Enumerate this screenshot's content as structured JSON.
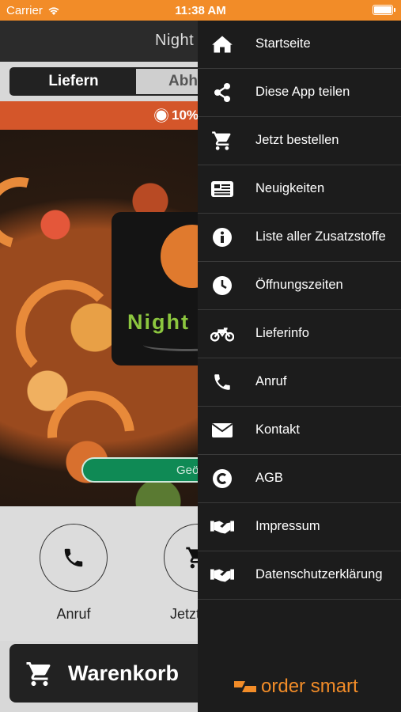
{
  "status_bar": {
    "carrier": "Carrier",
    "time": "11:38 AM"
  },
  "navbar": {
    "title": "Night I"
  },
  "order_mode": {
    "deliver_label": "Liefern",
    "pickup_label": "Abholen",
    "selected": "Liefern"
  },
  "promo": {
    "text": "10%"
  },
  "restaurant": {
    "logo_text": "Night",
    "status_pill": "Geö"
  },
  "quick_actions": [
    {
      "label": "Anruf",
      "icon": "phone-icon"
    },
    {
      "label": "Jetzt b",
      "icon": "cart-icon"
    }
  ],
  "cart": {
    "label": "Warenkorb"
  },
  "drawer": {
    "items": [
      {
        "label": "Startseite",
        "icon": "home-icon"
      },
      {
        "label": "Diese App teilen",
        "icon": "share-icon"
      },
      {
        "label": "Jetzt bestellen",
        "icon": "cart-icon"
      },
      {
        "label": "Neuigkeiten",
        "icon": "newspaper-icon"
      },
      {
        "label": "Liste aller Zusatzstoffe",
        "icon": "info-icon"
      },
      {
        "label": "Öffnungszeiten",
        "icon": "clock-icon"
      },
      {
        "label": "Lieferinfo",
        "icon": "motorcycle-icon"
      },
      {
        "label": "Anruf",
        "icon": "phone-icon"
      },
      {
        "label": "Kontakt",
        "icon": "envelope-icon"
      },
      {
        "label": "AGB",
        "icon": "copyright-icon"
      },
      {
        "label": "Impressum",
        "icon": "handshake-icon"
      },
      {
        "label": "Datenschutzerklärung",
        "icon": "handshake-icon"
      }
    ],
    "brand": "order smart"
  },
  "colors": {
    "accent": "#f28c28",
    "drawer_bg": "#1c1c1c",
    "promo": "#d4562a",
    "pill": "#0f8a55",
    "logo_green": "#8cc63f"
  }
}
